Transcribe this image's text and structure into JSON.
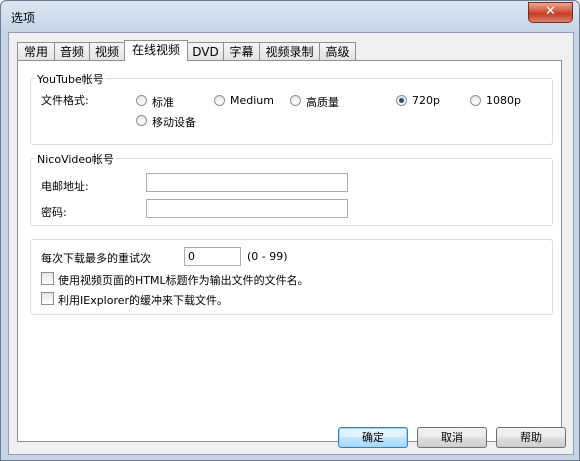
{
  "window": {
    "title": "选项",
    "close_symbol": "✕"
  },
  "tabs": [
    "常用",
    "音频",
    "视频",
    "在线视频",
    "DVD",
    "字幕",
    "视频录制",
    "高级"
  ],
  "youtube": {
    "group_title": "YouTube帐号",
    "format_label": "文件格式:",
    "options": [
      "标准",
      "Medium",
      "高质量",
      "720p",
      "1080p",
      "移动设备"
    ],
    "selected": "720p"
  },
  "nico": {
    "group_title": "NicoVideo帐号",
    "email_label": "电邮地址:",
    "email_value": "",
    "password_label": "密码:",
    "password_value": ""
  },
  "download": {
    "retry_label": "每次下载最多的重试次",
    "retry_value": "0",
    "retry_range": "(0 - 99)",
    "check_html_title": "使用视频页面的HTML标题作为输出文件的文件名。",
    "check_ie_cache": "利用IExplorer的缓冲来下载文件。"
  },
  "buttons": {
    "ok": "确定",
    "cancel": "取消",
    "help": "帮助"
  }
}
